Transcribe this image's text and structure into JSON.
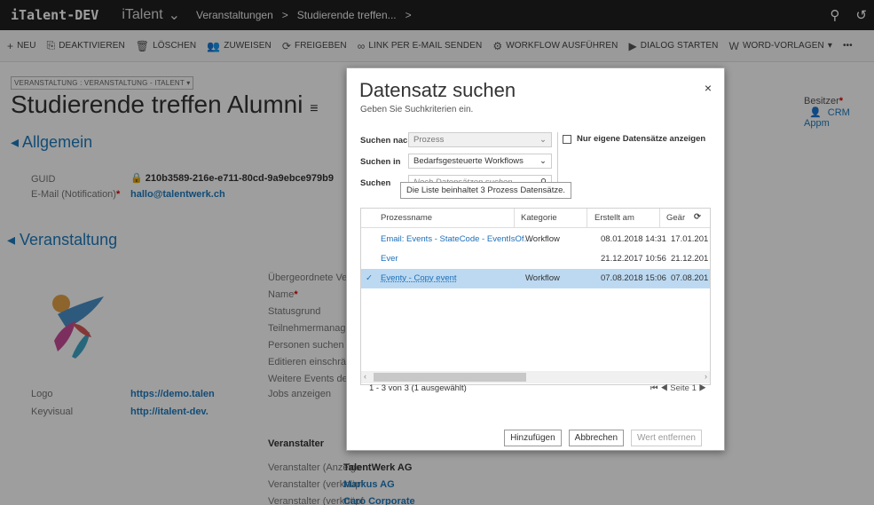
{
  "topnav": {
    "env": "iTalent-DEV",
    "app": "iTalent",
    "crumb1": "Veranstaltungen",
    "crumb2": "Studierende treffen...",
    "crumb_sep": ">",
    "crumb_more": ">",
    "search_glyph": "⚲",
    "history_glyph": "↺"
  },
  "commands": [
    {
      "label": "NEU",
      "icon": "+"
    },
    {
      "label": "DEAKTIVIEREN",
      "icon": "⎘"
    },
    {
      "label": "LÖSCHEN",
      "icon": "🗑"
    },
    {
      "label": "ZUWEISEN",
      "icon": "👥"
    },
    {
      "label": "FREIGEBEN",
      "icon": "⟳"
    },
    {
      "label": "LINK PER E-MAIL SENDEN",
      "icon": "∞"
    },
    {
      "label": "WORKFLOW AUSFÜHREN",
      "icon": "⚙"
    },
    {
      "label": "DIALOG STARTEN",
      "icon": "▶"
    },
    {
      "label": "WORD-VORLAGEN",
      "icon": "W"
    },
    {
      "label": "•••",
      "icon": ""
    }
  ],
  "form": {
    "entity_selector": "VERANSTALTUNG : VERANSTALTUNG - ITALENT ▾",
    "title": "Studierende treffen Alumni",
    "title_menu": "≡",
    "sections": {
      "general": "◂ Allgemein",
      "event": "◂ Veranstaltung"
    },
    "fields": {
      "guid_label": "GUID",
      "guid_value": "210b3589-216e-e711-80cd-9a9ebce979b9",
      "email_label": "E-Mail (Notification)",
      "email_value": "hallo@talentwerk.ch",
      "logo_label": "Logo",
      "logo_value": "https://demo.talen",
      "keyvisual_label": "Keyvisual",
      "keyvisual_value": "http://italent-dev.",
      "parent_label": "Übergeordnete Ve",
      "name_label": "Name",
      "status_label": "Statusgrund",
      "participant_label": "Teilnehmermanage",
      "persons_label": "Personen suchen &",
      "edit_label": "Editieren einschrän",
      "more_events_label": "Weitere Events des",
      "jobs_label": "Jobs anzeigen",
      "organizer_heading": "Veranstalter",
      "organizer_label1": "Veranstalter (Anzeige",
      "organizer_value1": "TalentWerk AG",
      "organizer_label2": "Veranstalter (verknüpf",
      "organizer_value2": "Markus AG",
      "organizer_label3": "Veranstalter (verknüpf",
      "organizer_value3": "Caro Corporate"
    },
    "owner_label": "Besitzer",
    "owner_value": "CRM Appm"
  },
  "dialog": {
    "title": "Datensatz suchen",
    "subtitle": "Geben Sie Suchkriterien ein.",
    "close": "×",
    "search_by_label": "Suchen nach",
    "search_by_value": "Prozess",
    "search_in_label": "Suchen in",
    "search_in_value": "Bedarfsgesteuerte Workflows",
    "search_label": "Suchen",
    "search_placeholder": "Noch Datensätzen suchen",
    "own_only_label": "Nur eigene Datensätze anzeigen",
    "columns": [
      "Prozessname",
      "Kategorie",
      "Erstellt am",
      "Geär"
    ],
    "rows": [
      {
        "name": "Email: Events - StateCode - EventIsOf...",
        "category": "Workflow",
        "created": "08.01.2018 14:31",
        "modified": "17.01.201"
      },
      {
        "name": "Ever",
        "category": "",
        "created": "21.12.2017 10:56",
        "modified": "21.12.201"
      },
      {
        "name": "Eventy - Copy event",
        "category": "Workflow",
        "created": "07.08.2018 15:06",
        "modified": "07.08.201"
      }
    ],
    "tooltip": "Die Liste beinhaltet 3 Prozess Datensätze.",
    "footer_count": "1 - 3  von 3 (1 ausgewählt)",
    "pager": "⏮  ◀  Seite 1  ▶",
    "btn_add": "Hinzufügen",
    "btn_cancel": "Abbrechen",
    "btn_remove": "Wert entfernen",
    "check_mark": "✓",
    "refresh_glyph": "⟳"
  }
}
